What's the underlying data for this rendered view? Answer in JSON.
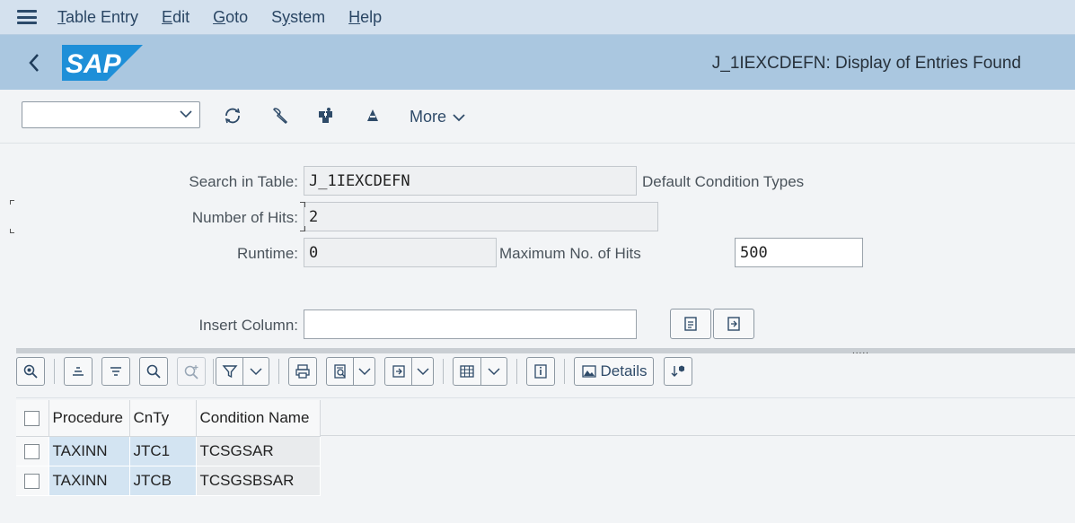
{
  "menu": {
    "items": [
      {
        "label": "Table Entry",
        "ul": "T"
      },
      {
        "label": "Edit",
        "ul": "E"
      },
      {
        "label": "Goto",
        "ul": "G"
      },
      {
        "label": "System",
        "ul": "y"
      },
      {
        "label": "Help",
        "ul": "H"
      }
    ]
  },
  "header": {
    "logo_text": "SAP",
    "title": "J_1IEXCDEFN: Display of Entries Found"
  },
  "toolbar": {
    "more_label": "More"
  },
  "form": {
    "search_label": "Search in Table:",
    "search_value": "J_1IEXCDEFN",
    "search_desc": "Default Condition Types",
    "hits_label": "Number of Hits:",
    "hits_value": "2",
    "runtime_label": "Runtime:",
    "runtime_value": "0",
    "max_hits_label": "Maximum No. of Hits",
    "max_hits_value": "500",
    "insert_label": "Insert Column:",
    "insert_value": ""
  },
  "grid": {
    "details_label": "Details",
    "columns": [
      "Procedure",
      "CnTy",
      "Condition Name"
    ],
    "rows": [
      [
        "TAXINN",
        "JTC1",
        "TCSGSAR"
      ],
      [
        "TAXINN",
        "JTCB",
        "TCSGSBSAR"
      ]
    ]
  },
  "colors": {
    "menubar": "#d4e1ee",
    "titlebar": "#aac7e0",
    "logo": "#1e8fd8",
    "key_cell": "#d3e4f2"
  }
}
